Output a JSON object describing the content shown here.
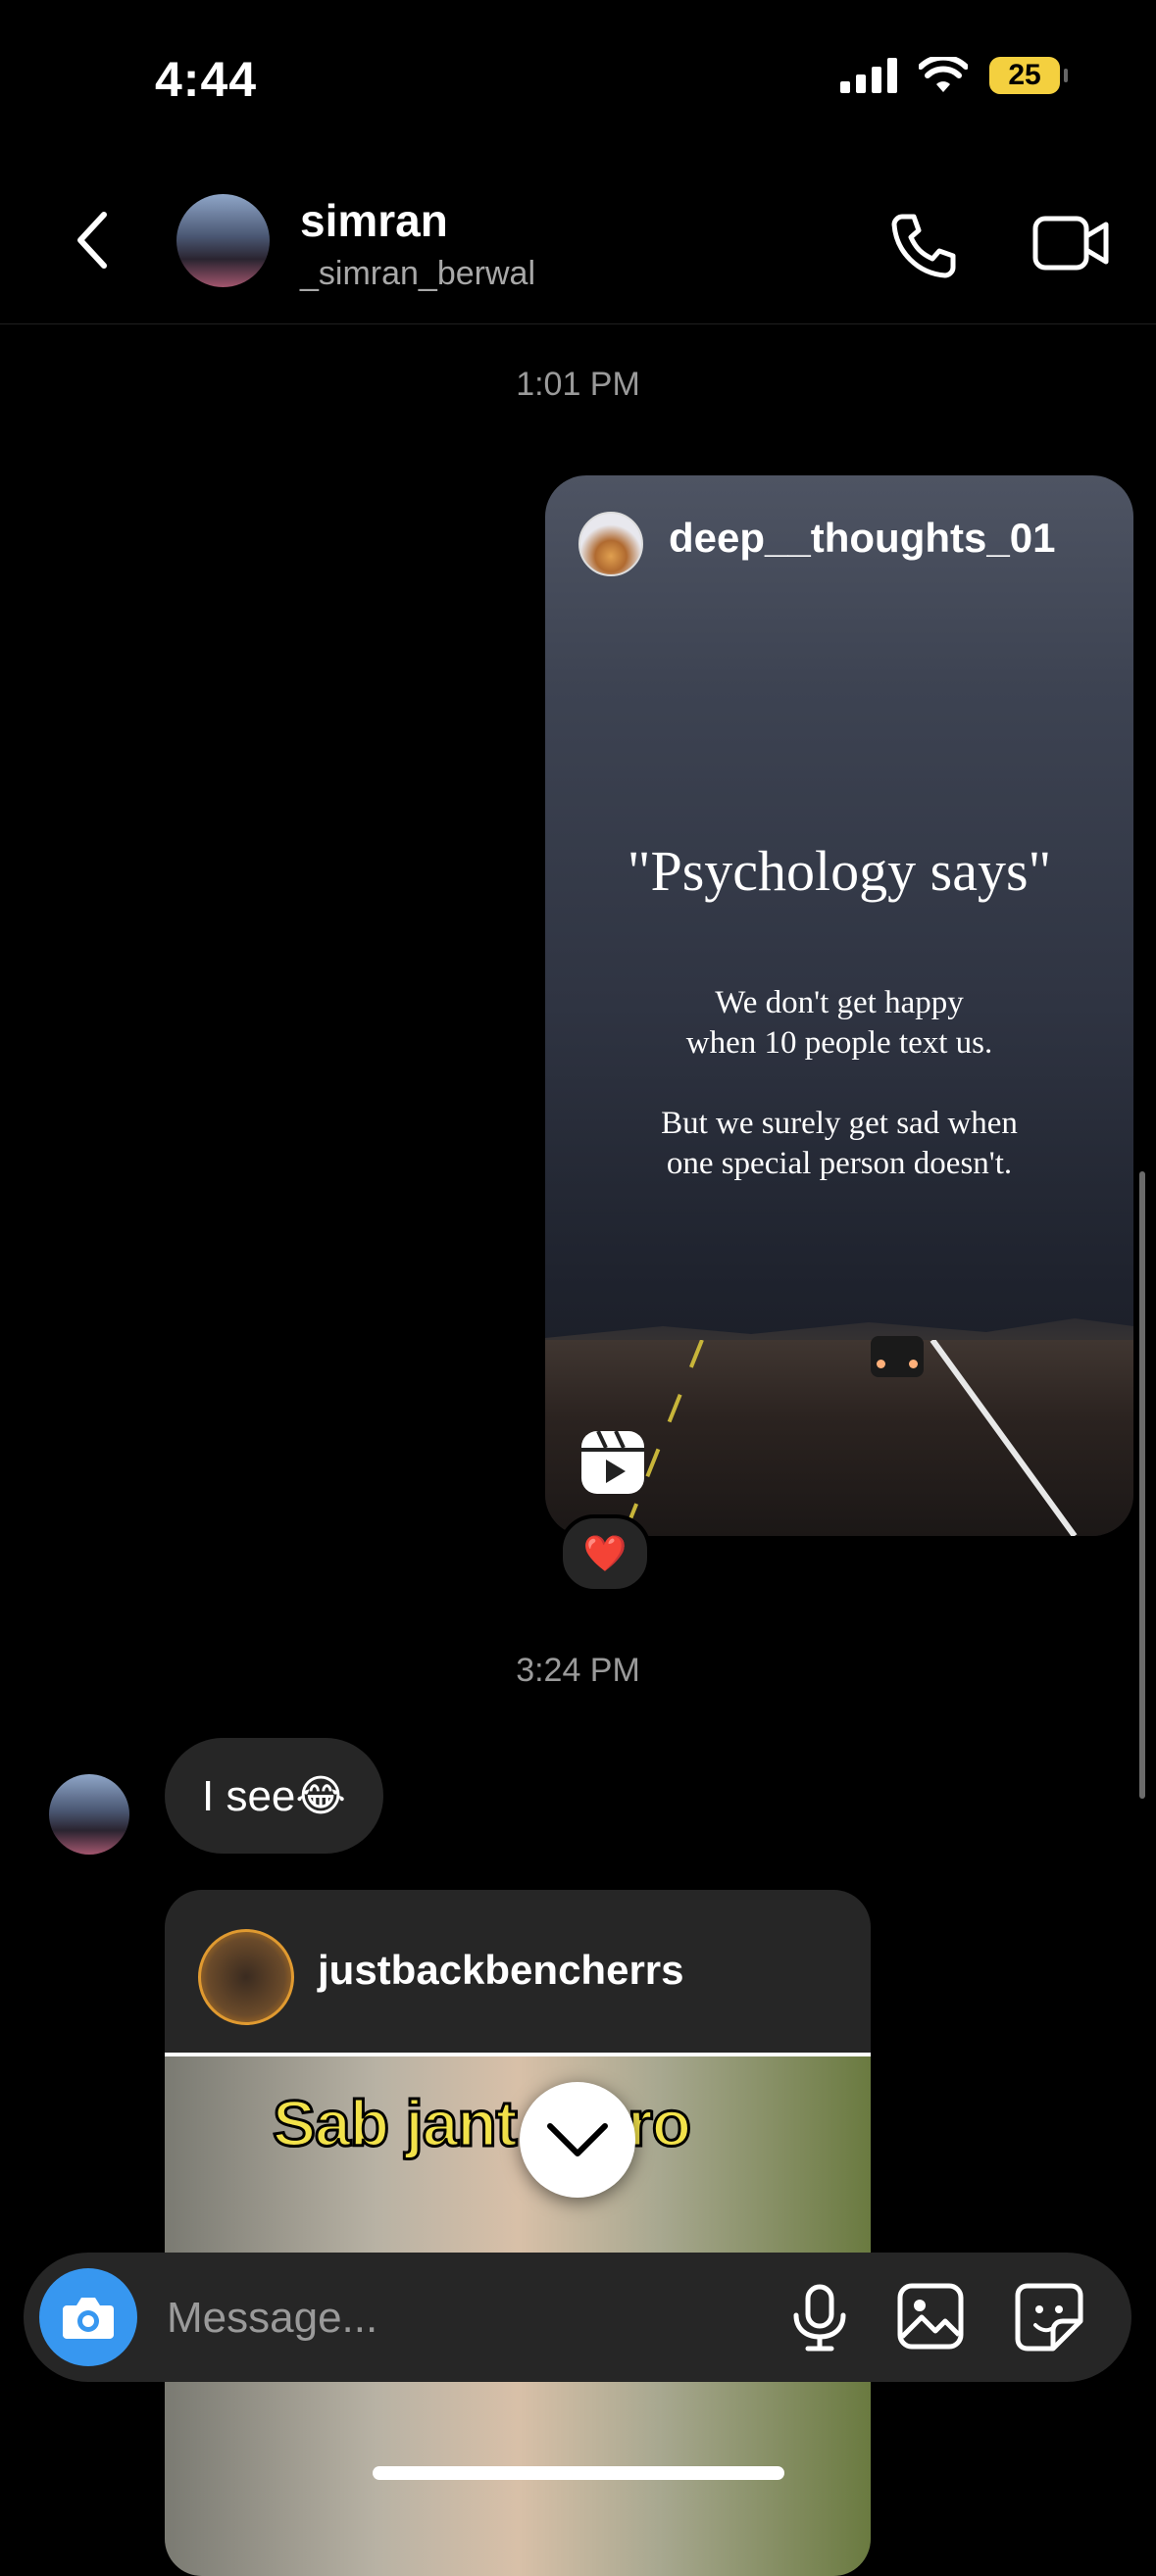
{
  "status_bar": {
    "time": "4:44",
    "battery": "25",
    "battery_color": "#f4d03f"
  },
  "header": {
    "name": "simran",
    "username": "_simran_berwal",
    "back_icon": "chevron-left-icon",
    "call_icon": "phone-icon",
    "video_icon": "video-camera-icon"
  },
  "thread": {
    "timestamp_1": "1:01 PM",
    "shared_reel": {
      "author": "deep__thoughts_01",
      "title": "\"Psychology says\"",
      "line_1": "We don't get happy",
      "line_2": "when 10 people text us.",
      "line_3": "But we surely get sad when",
      "line_4": "one special person doesn't.",
      "reel_icon": "reels-icon"
    },
    "reaction": "❤️",
    "timestamp_2": "3:24 PM",
    "received_message": "I see😂",
    "shared_post": {
      "author": "justbackbencherrs",
      "caption": "Sab jant   u bro"
    }
  },
  "composer": {
    "placeholder": "Message...",
    "accent_color": "#3797f0"
  }
}
